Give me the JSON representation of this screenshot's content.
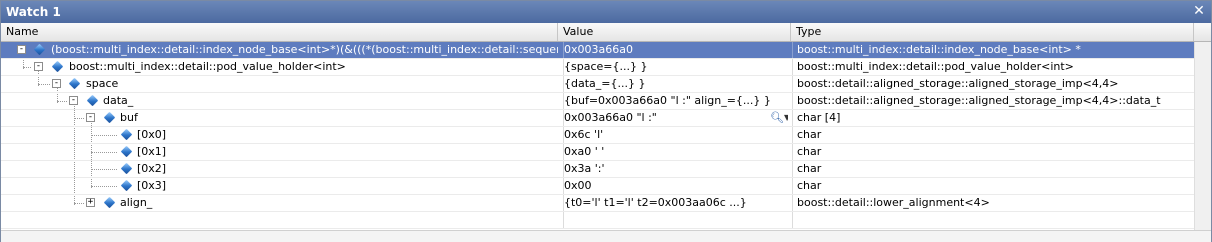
{
  "window": {
    "title": "Watch 1",
    "close_glyph": "✕"
  },
  "columns": {
    "name": "Name",
    "value": "Value",
    "type": "Type"
  },
  "rows": [
    {
      "name": "(boost::multi_index::detail::index_node_base<int>*)(&(((*(boost::multi_index::detail::sequenced_index",
      "value": "0x003a66a0",
      "type": "boost::multi_index::detail::index_node_base<int> *",
      "expander": "-"
    },
    {
      "name": "boost::multi_index::detail::pod_value_holder<int>",
      "value": "{space={...} }",
      "type": "boost::multi_index::detail::pod_value_holder<int>",
      "expander": "-"
    },
    {
      "name": "space",
      "value": "{data_={...} }",
      "type": "boost::detail::aligned_storage::aligned_storage_imp<4,4>",
      "expander": "-"
    },
    {
      "name": "data_",
      "value": "{buf=0x003a66a0 \"l :\" align_={...} }",
      "type": "boost::detail::aligned_storage::aligned_storage_imp<4,4>::data_t",
      "expander": "-"
    },
    {
      "name": "buf",
      "value": "0x003a66a0 \"l :\"",
      "type": "char [4]",
      "expander": "-"
    },
    {
      "name": "[0x0]",
      "value": "0x6c 'l'",
      "type": "char"
    },
    {
      "name": "[0x1]",
      "value": "0xa0 ' '",
      "type": "char"
    },
    {
      "name": "[0x2]",
      "value": "0x3a ':'",
      "type": "char"
    },
    {
      "name": "[0x3]",
      "value": "0x00",
      "type": "char"
    },
    {
      "name": "align_",
      "value": "{t0='l' t1='l' t2=0x003aa06c ...}",
      "type": "boost::detail::lower_alignment<4>",
      "expander": "+"
    }
  ],
  "colors": {
    "selection": "#5e7cbf",
    "titlebar": "#5a77ac"
  },
  "icons": {
    "member": "member-gem-icon",
    "inspect": "magnifier-icon"
  }
}
